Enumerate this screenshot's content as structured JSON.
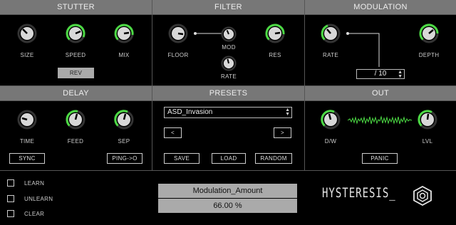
{
  "sections": {
    "stutter": "STUTTER",
    "filter": "FILTER",
    "modulation": "MODULATION",
    "delay": "DELAY",
    "presets": "PRESETS",
    "out": "OUT"
  },
  "stutter": {
    "knobs": [
      {
        "label": "SIZE",
        "value": 0.35,
        "active": false
      },
      {
        "label": "SPEED",
        "value": 0.7,
        "active": true
      },
      {
        "label": "MIX",
        "value": 0.75,
        "active": true
      }
    ],
    "rev_label": "REV"
  },
  "filter": {
    "floor_label": "FLOOR",
    "mod_label": "MOD",
    "rate_label": "RATE",
    "res_label": "RES"
  },
  "modulation": {
    "rate_label": "RATE",
    "depth_label": "DEPTH",
    "division": "/ 10"
  },
  "delay": {
    "time_label": "TIME",
    "feed_label": "FEED",
    "sep_label": "SEP",
    "sync_label": "SYNC",
    "pingpong_label": "PING->O"
  },
  "presets": {
    "selected": "ASD_Invasion",
    "prev_label": "<",
    "next_label": ">",
    "save_label": "SAVE",
    "load_label": "LOAD",
    "random_label": "RANDOM"
  },
  "out": {
    "dw_label": "D/W",
    "lvl_label": "LVL",
    "panic_label": "PANIC"
  },
  "midi": {
    "learn_label": "LEARN",
    "unlearn_label": "UNLEARN",
    "clear_label": "CLEAR"
  },
  "param": {
    "name": "Modulation_Amount",
    "value": "66.00 %"
  },
  "brand": {
    "logo_text": "HYSTERESIS_"
  },
  "colors": {
    "accent": "#4cd944",
    "header": "#777777",
    "knob_body": "#d8d8d8"
  }
}
